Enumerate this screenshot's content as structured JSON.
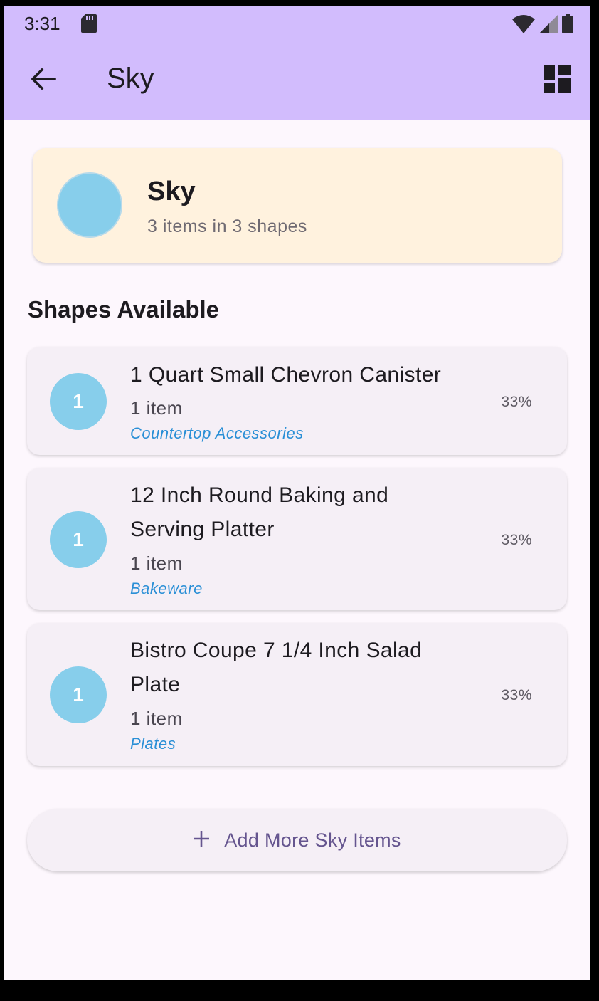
{
  "status_bar": {
    "time": "3:31"
  },
  "app_bar": {
    "title": "Sky",
    "back_icon": "arrow-back-icon",
    "action_icon": "dashboard-icon"
  },
  "summary": {
    "title": "Sky",
    "subtitle": "3 items in 3 shapes",
    "swatch_color": "#87ceeb"
  },
  "section_title": "Shapes Available",
  "colors": {
    "accent": "#d2bcfd",
    "swatch": "#87ceeb",
    "category_link": "#2a8fd6",
    "button_text": "#65558f"
  },
  "shapes": [
    {
      "count": "1",
      "name": "1 Quart Small Chevron Canister",
      "items": "1 item",
      "category": "Countertop Accessories",
      "percent": "33%",
      "share": 0.33
    },
    {
      "count": "1",
      "name_line1": "12 Inch Round Baking and",
      "name_line2": "Serving Platter",
      "items": "1 item",
      "category": "Bakeware",
      "percent": "33%",
      "share": 0.33
    },
    {
      "count": "1",
      "name_line1": "Bistro Coupe 7 1/4 Inch Salad",
      "name_line2": "Plate",
      "items": "1 item",
      "category": "Plates",
      "percent": "33%",
      "share": 0.33
    }
  ],
  "add_button": {
    "label": "Add More Sky Items",
    "icon": "plus-icon"
  }
}
